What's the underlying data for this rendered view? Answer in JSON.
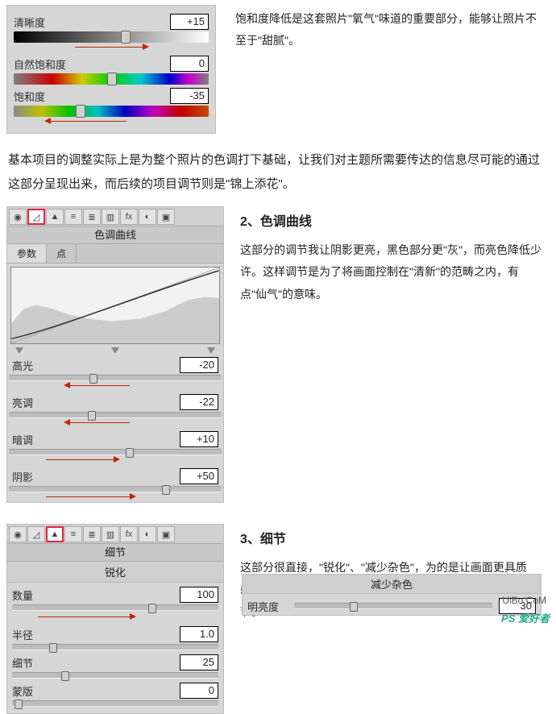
{
  "panel1": {
    "clarity": {
      "label": "清晰度",
      "value": "+15"
    },
    "vibrance": {
      "label": "自然饱和度",
      "value": "0"
    },
    "saturation": {
      "label": "饱和度",
      "value": "-35"
    }
  },
  "side1": "饱和度降低是这套照片\"氧气\"味道的重要部分，能够让照片不至于\"甜腻\"。",
  "para1": "基本项目的调整实际上是为整个照片的色调打下基础，让我们对主题所需要传达的信息尽可能的通过这部分呈现出来，而后续的项目调节则是\"锦上添花\"。",
  "panel2": {
    "title": "色调曲线",
    "tabs": {
      "a": "参数",
      "b": "点"
    },
    "highlights": {
      "label": "高光",
      "value": "-20"
    },
    "lights": {
      "label": "亮调",
      "value": "-22"
    },
    "darks": {
      "label": "暗调",
      "value": "+10"
    },
    "shadows": {
      "label": "阴影",
      "value": "+50"
    }
  },
  "section2": {
    "heading": "2、色调曲线",
    "text": "这部分的调节我让阴影更亮，黑色部分更\"灰\"，而亮色降低少许。这样调节是为了将画面控制在\"清新\"的范畴之内，有点\"仙气\"的意味。"
  },
  "panel3": {
    "title": "细节",
    "sub": "锐化",
    "amount": {
      "label": "数量",
      "value": "100"
    },
    "radius": {
      "label": "半径",
      "value": "1.0"
    },
    "detail": {
      "label": "细节",
      "value": "25"
    },
    "mask": {
      "label": "蒙版",
      "value": "0"
    }
  },
  "section3": {
    "heading": "3、细节",
    "text": "这部分很直接，\"锐化\"、\"减少杂色\"，为的是让画面更具质感，但又不损失太多画质，所以两个看似对立的选项都要调节。"
  },
  "noise": {
    "title": "减少杂色",
    "luminance": {
      "label": "明亮度",
      "value": "30"
    }
  },
  "watermark": {
    "url": "UiBo.CoM",
    "brand": "PS 爱好者"
  }
}
